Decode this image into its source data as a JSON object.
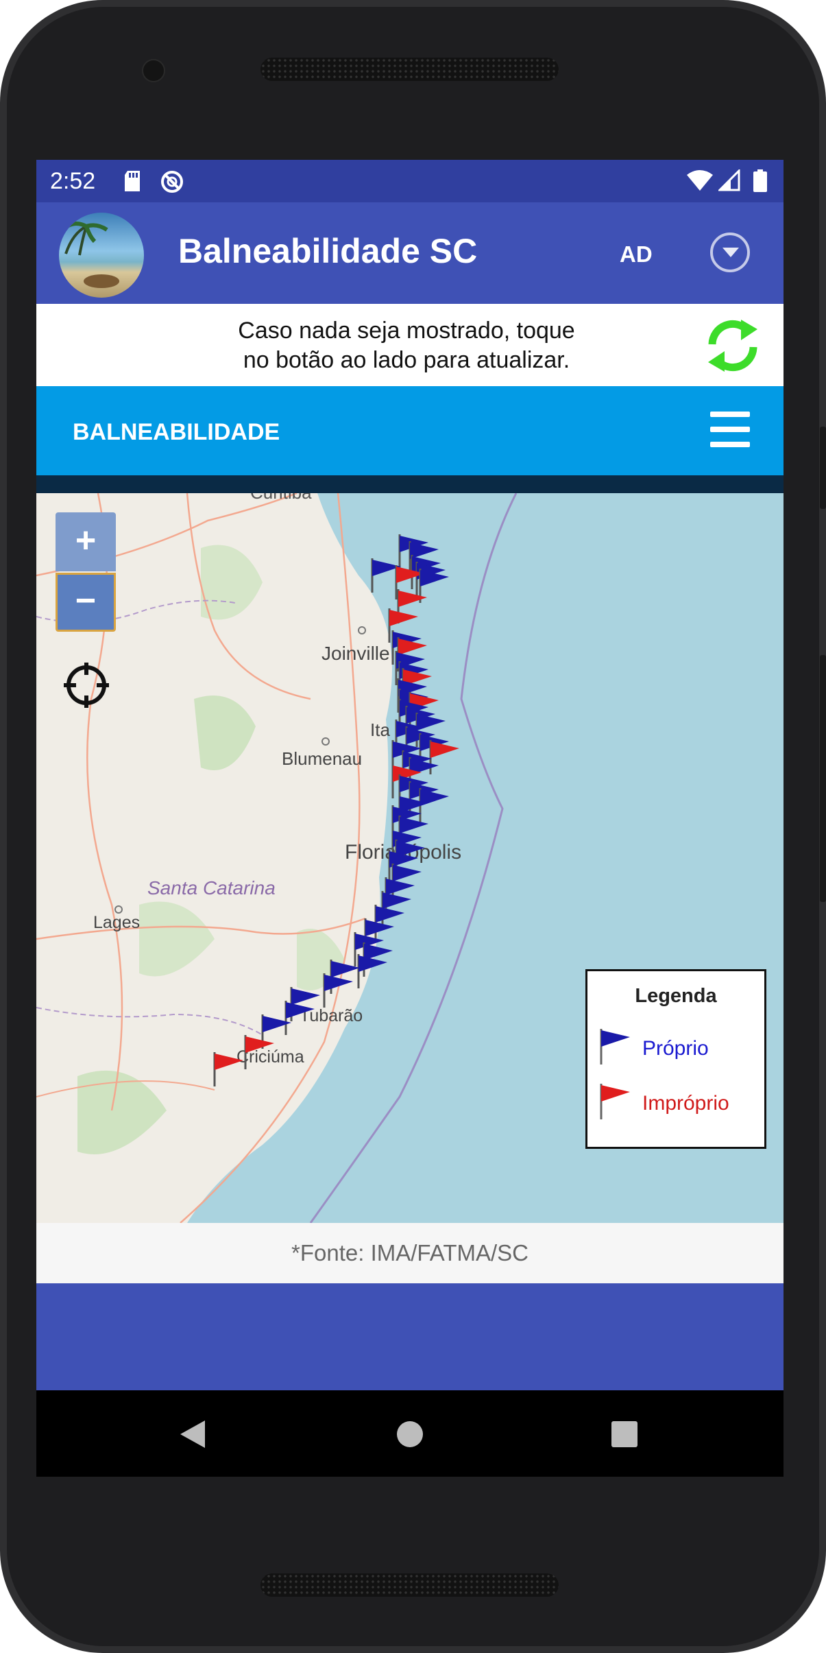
{
  "status_bar": {
    "time": "2:52",
    "icons": [
      "sd-card-icon",
      "do-not-disturb-icon",
      "wifi-icon",
      "cell-signal-icon",
      "battery-icon"
    ]
  },
  "app_bar": {
    "title": "Balneabilidade SC",
    "ad_label": "AD",
    "avatar_icon": "beach-avatar-icon",
    "dropdown_icon": "chevron-down-circle-icon"
  },
  "notice": {
    "text": "Caso nada seja mostrado, toque\n no botão ao lado para atualizar.",
    "refresh_icon": "refresh-icon",
    "refresh_color": "#3ddc2a"
  },
  "menu_bar": {
    "title": "BALNEABILIDADE",
    "menu_icon": "hamburger-menu-icon"
  },
  "map": {
    "zoom_in_label": "+",
    "zoom_out_label": "−",
    "locate_icon": "crosshair-icon",
    "places": {
      "curitiba": "Curitiba",
      "joinville": "Joinville",
      "itajai": "Ita",
      "blumenau": "Blumenau",
      "florianopolis": "Florianópolis",
      "santa_catarina": "Santa Catarina",
      "lages": "Lages",
      "tubarao": "Tubarão",
      "criciuma": "Criciúma"
    },
    "legend": {
      "title": "Legenda",
      "proprio": "Próprio",
      "improprio": "Impróprio",
      "proprio_color": "#1a1aa8",
      "improprio_color": "#e01e1e"
    },
    "colors": {
      "sea": "#aad3df",
      "land": "#f0ede6",
      "forest": "#cfe3c1"
    }
  },
  "source_note": "*Fonte: IMA/FATMA/SC",
  "nav": {
    "back_icon": "back-triangle-icon",
    "home_icon": "home-circle-icon",
    "recents_icon": "recents-square-icon"
  }
}
